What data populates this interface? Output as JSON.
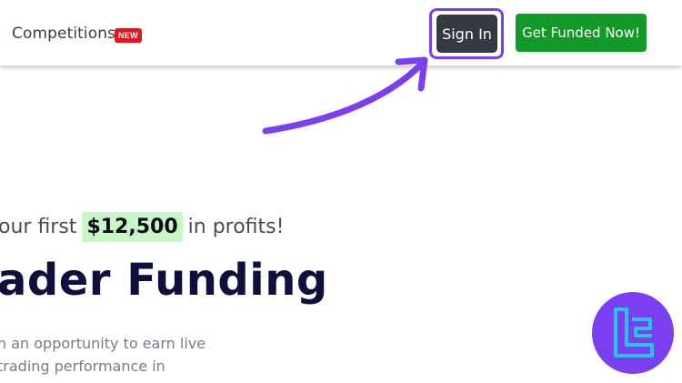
{
  "navbar": {
    "competitions_label": "Competitions",
    "new_badge": "NEW",
    "signin_label": "Sign In",
    "get_funded_label": "Get Funded Now!"
  },
  "hero": {
    "subtitle_before": "our first",
    "subtitle_amount": "$12,500",
    "subtitle_after": "in profits!",
    "title": "ader Funding",
    "desc_line1": "n an opportunity to earn live",
    "desc_line2": "trading performance in"
  },
  "icons": {
    "arrow": "arrow-annotation-icon",
    "logo": "tc-logo-icon"
  },
  "colors": {
    "signin_bg": "#343a40",
    "signin_highlight": "#7b3ff2",
    "funded_bg": "#139928",
    "badge_bg": "#e8141c",
    "amount_highlight_bg": "#c9f6c7",
    "title_color": "#0e0f3c",
    "arrow_color": "#7b3ff2",
    "logo_bg": "#7b3ff2",
    "logo_stroke": "#27c4e8"
  }
}
